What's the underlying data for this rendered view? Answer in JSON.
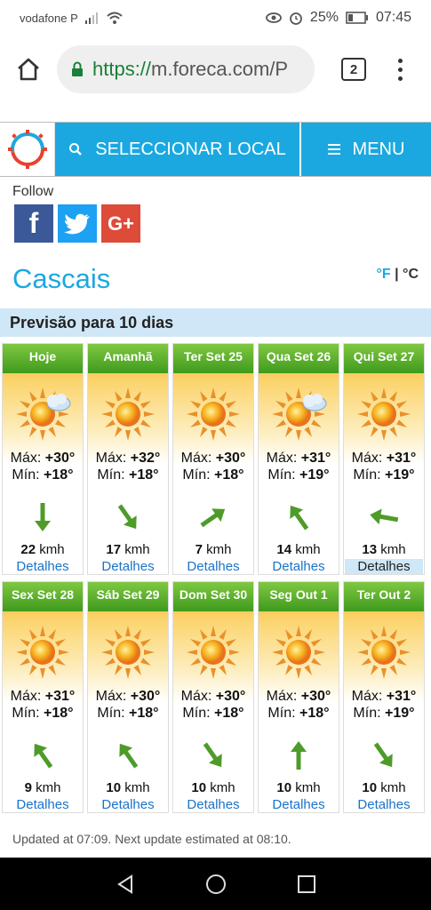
{
  "status": {
    "carrier": "vodafone P",
    "battery": "25%",
    "time": "07:45"
  },
  "browser": {
    "url_scheme": "https://",
    "url_host": "m.foreca.com/P",
    "tab_count": "2"
  },
  "nav": {
    "select_location": "SELECCIONAR LOCAL",
    "menu": "MENU"
  },
  "follow_label": "Follow",
  "social": {
    "facebook": "f",
    "google": "G+"
  },
  "city": "Cascais",
  "units": {
    "fahrenheit": "°F",
    "separator": " | ",
    "celsius": "°C"
  },
  "forecast_title": "Previsão para 10 dias",
  "days": [
    {
      "name": "Hoje",
      "icon": "sun-cloud-icon",
      "max": "+30°",
      "min": "+18°",
      "wind": "22",
      "wind_dir": 180,
      "unit": "kmh",
      "details": "Detalhes"
    },
    {
      "name": "Amanhã",
      "icon": "sun-icon",
      "max": "+32°",
      "min": "+18°",
      "wind": "17",
      "wind_dir": 145,
      "unit": "kmh",
      "details": "Detalhes"
    },
    {
      "name": "Ter Set 25",
      "icon": "sun-icon",
      "max": "+30°",
      "min": "+18°",
      "wind": "7",
      "wind_dir": 55,
      "unit": "kmh",
      "details": "Detalhes"
    },
    {
      "name": "Qua Set 26",
      "icon": "sun-cloud-icon",
      "max": "+31°",
      "min": "+19°",
      "wind": "14",
      "wind_dir": 325,
      "unit": "kmh",
      "details": "Detalhes"
    },
    {
      "name": "Qui Set 27",
      "icon": "sun-icon",
      "max": "+31°",
      "min": "+19°",
      "wind": "13",
      "wind_dir": 280,
      "unit": "kmh",
      "details": "Detalhes"
    },
    {
      "name": "Sex Set 28",
      "icon": "sun-icon",
      "max": "+31°",
      "min": "+18°",
      "wind": "9",
      "wind_dir": 325,
      "unit": "kmh",
      "details": "Detalhes"
    },
    {
      "name": "Sáb Set 29",
      "icon": "sun-icon",
      "max": "+30°",
      "min": "+18°",
      "wind": "10",
      "wind_dir": 325,
      "unit": "kmh",
      "details": "Detalhes"
    },
    {
      "name": "Dom Set 30",
      "icon": "sun-icon",
      "max": "+30°",
      "min": "+18°",
      "wind": "10",
      "wind_dir": 145,
      "unit": "kmh",
      "details": "Detalhes"
    },
    {
      "name": "Seg Out 1",
      "icon": "sun-icon",
      "max": "+30°",
      "min": "+18°",
      "wind": "10",
      "wind_dir": 0,
      "unit": "kmh",
      "details": "Detalhes"
    },
    {
      "name": "Ter Out 2",
      "icon": "sun-icon",
      "max": "+31°",
      "min": "+19°",
      "wind": "10",
      "wind_dir": 145,
      "unit": "kmh",
      "details": "Detalhes"
    }
  ],
  "max_label": "Máx:",
  "min_label": "Mín:",
  "updated": "Updated at 07:09. Next update estimated at 08:10."
}
